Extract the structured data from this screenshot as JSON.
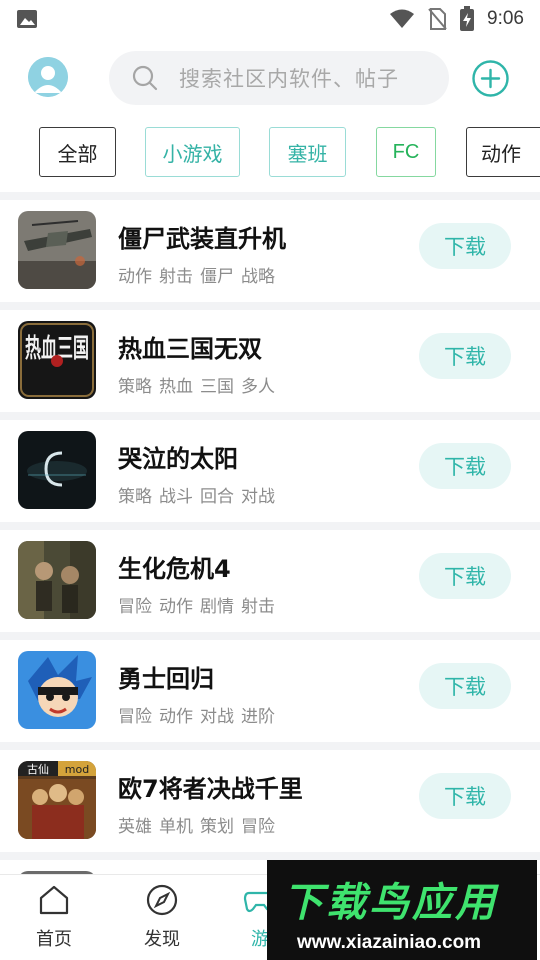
{
  "status_bar": {
    "time": "9:06",
    "icons": [
      "image-icon",
      "wifi-icon",
      "no-sim-icon",
      "battery-charging-icon"
    ]
  },
  "header": {
    "avatar_icon": "user-avatar-icon",
    "search_placeholder": "搜索社区内软件、帖子",
    "search_icon": "search-icon",
    "add_icon": "plus-circle-icon"
  },
  "categories": [
    "全部",
    "小游戏",
    "塞班",
    "FC",
    "动作"
  ],
  "colors": {
    "accent": "#2fb5a9",
    "button_bg": "#e6f6f5",
    "tag_text": "#8c8c8c"
  },
  "download_label": "下载",
  "games": [
    {
      "title": "僵尸武装直升机",
      "tags": [
        "动作",
        "射击",
        "僵尸",
        "战略"
      ]
    },
    {
      "title": "热血三国无双",
      "tags": [
        "策略",
        "热血",
        "三国",
        "多人"
      ]
    },
    {
      "title": "哭泣的太阳",
      "tags": [
        "策略",
        "战斗",
        "回合",
        "对战"
      ]
    },
    {
      "title": "生化危机4",
      "tags": [
        "冒险",
        "动作",
        "剧情",
        "射击"
      ]
    },
    {
      "title": "勇士回归",
      "tags": [
        "冒险",
        "动作",
        "对战",
        "进阶"
      ]
    },
    {
      "title": "欧7将者决战千里",
      "tags": [
        "英雄",
        "单机",
        "策划",
        "冒险"
      ]
    }
  ],
  "thumb_labels": {
    "rexue": "热血三国",
    "ouqi_badge_left": "古仙",
    "ouqi_badge_right": "mod"
  },
  "bottom_nav": {
    "home": "首页",
    "discover": "发现",
    "game": "游"
  },
  "watermark": {
    "logo": "下载鸟应用",
    "url": "www.xiazainiao.com"
  }
}
